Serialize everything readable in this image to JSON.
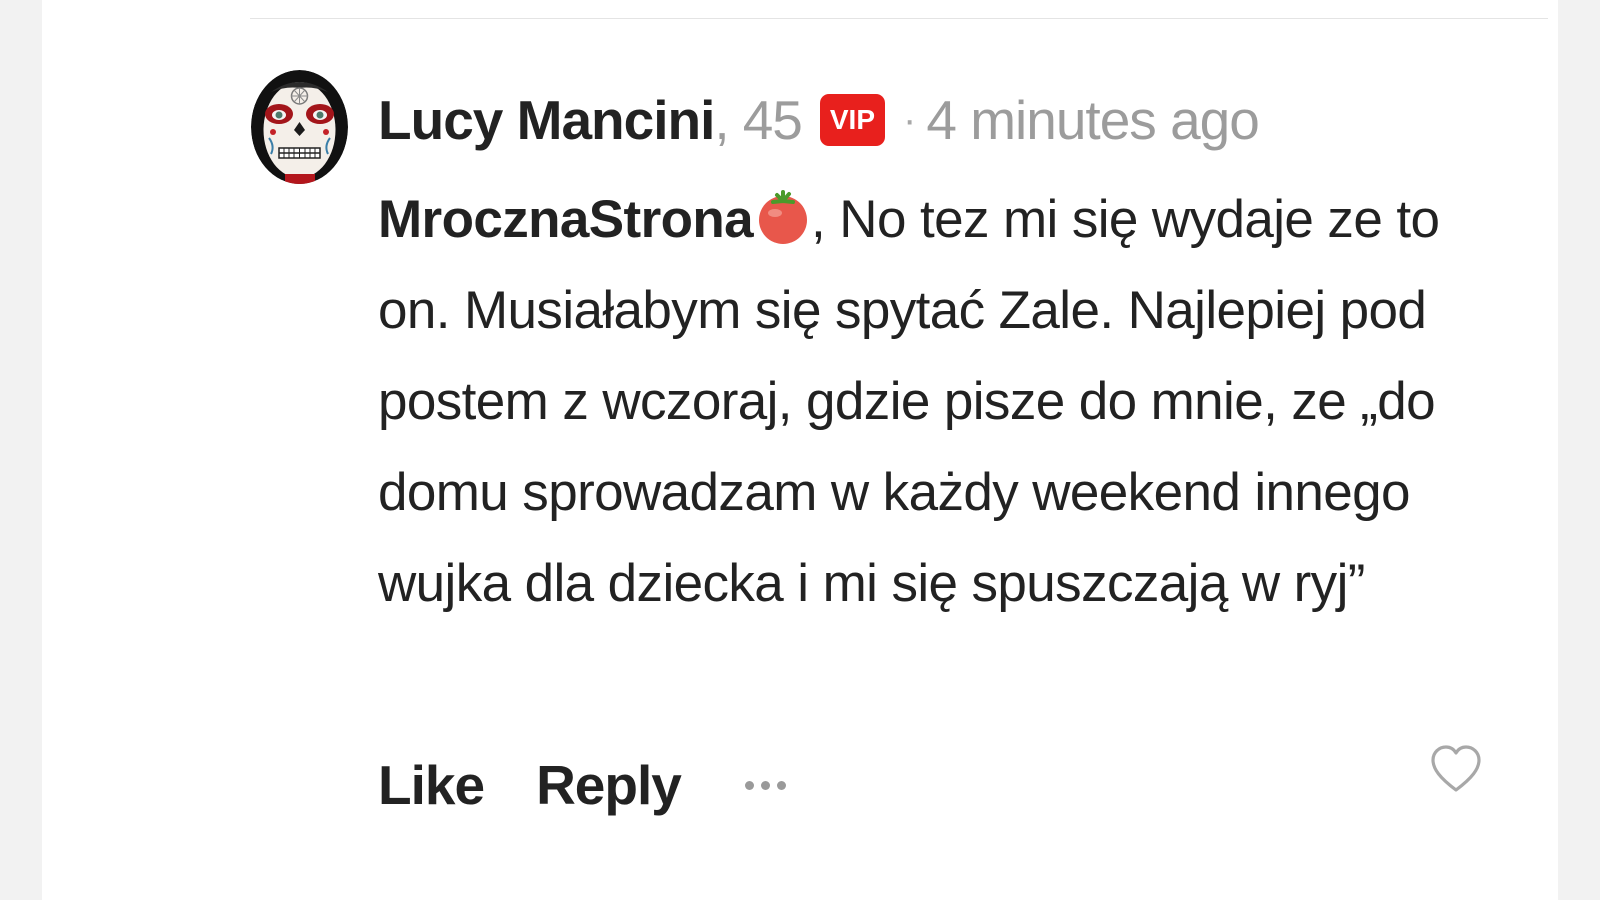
{
  "comment": {
    "author": "Lucy Mancini",
    "age_separator": ",",
    "age": "45",
    "badge": "VIP",
    "dot": "·",
    "time": "4 minutes ago",
    "mention": "MrocznaStrona",
    "mention_emoji": "tomato-emoji",
    "text": ", No tez mi się wydaje ze to on. Musiałabym się spytać Zale. Najlepiej pod postem z wczoraj, gdzie pisze do mnie, ze „do domu sprowadzam w każdy weekend innego wujka dla dziecka i mi się spuszczają w ryj”"
  },
  "actions": {
    "like": "Like",
    "reply": "Reply",
    "more_icon": "more-dots-icon",
    "heart_icon": "heart-icon"
  },
  "colors": {
    "badge_bg": "#e8201d",
    "text": "#222222",
    "muted": "#9c9c9c",
    "heart": "#a8a8a8"
  }
}
